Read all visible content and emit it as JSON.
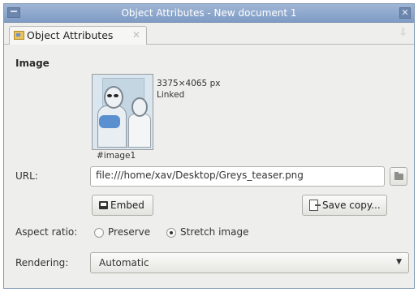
{
  "window": {
    "title": "Object Attributes - New document 1"
  },
  "tab": {
    "label": "Object Attributes"
  },
  "image_section": {
    "title": "Image",
    "size_text": "3375×4065 px",
    "status_text": "Linked",
    "id_text": "#image1"
  },
  "url": {
    "label": "URL:",
    "value": "file:///home/xav/Desktop/Greys_teaser.png"
  },
  "buttons": {
    "embed": "Embed",
    "save_copy": "Save copy..."
  },
  "aspect": {
    "label": "Aspect ratio:",
    "preserve": "Preserve",
    "stretch": "Stretch image",
    "selected": "Stretch image"
  },
  "rendering": {
    "label": "Rendering:",
    "value": "Automatic"
  }
}
